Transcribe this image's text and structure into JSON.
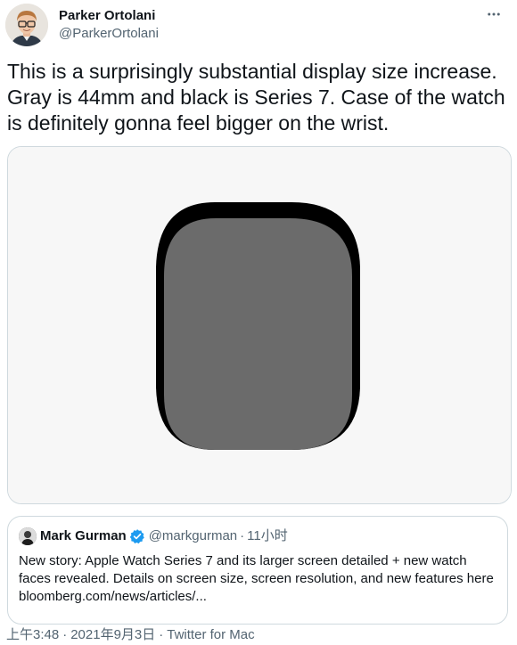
{
  "author": {
    "display_name": "Parker Ortolani",
    "handle": "@ParkerOrtolani"
  },
  "tweet": {
    "text": "This is a surprisingly substantial display size increase. Gray is 44mm and black is Series 7. Case of the watch is definitely gonna feel bigger on the wrist."
  },
  "media": {
    "description_icon": "watch-display-comparison",
    "colors": {
      "background": "#f7f7f7",
      "series7_black": "#000000",
      "gray_44mm": "#6b6b6b"
    }
  },
  "quote": {
    "display_name": "Mark Gurman",
    "handle": "@markgurman",
    "dot": "·",
    "time": "11小时",
    "verified_icon": "verified-badge-icon",
    "text_lines": [
      "New story: Apple Watch Series 7 and its larger screen detailed + new watch",
      "faces revealed. Details on screen size, screen resolution, and new features here",
      "bloomberg.com/news/articles/..."
    ]
  },
  "meta": {
    "time": "上午3:48",
    "dot1": "·",
    "date": "2021年9月3日",
    "dot2": "·",
    "source": "Twitter for Mac"
  },
  "colors": {
    "text_primary": "#0f1419",
    "text_secondary": "#536471",
    "border": "#cfd9de",
    "verified_blue": "#1d9bf0"
  }
}
